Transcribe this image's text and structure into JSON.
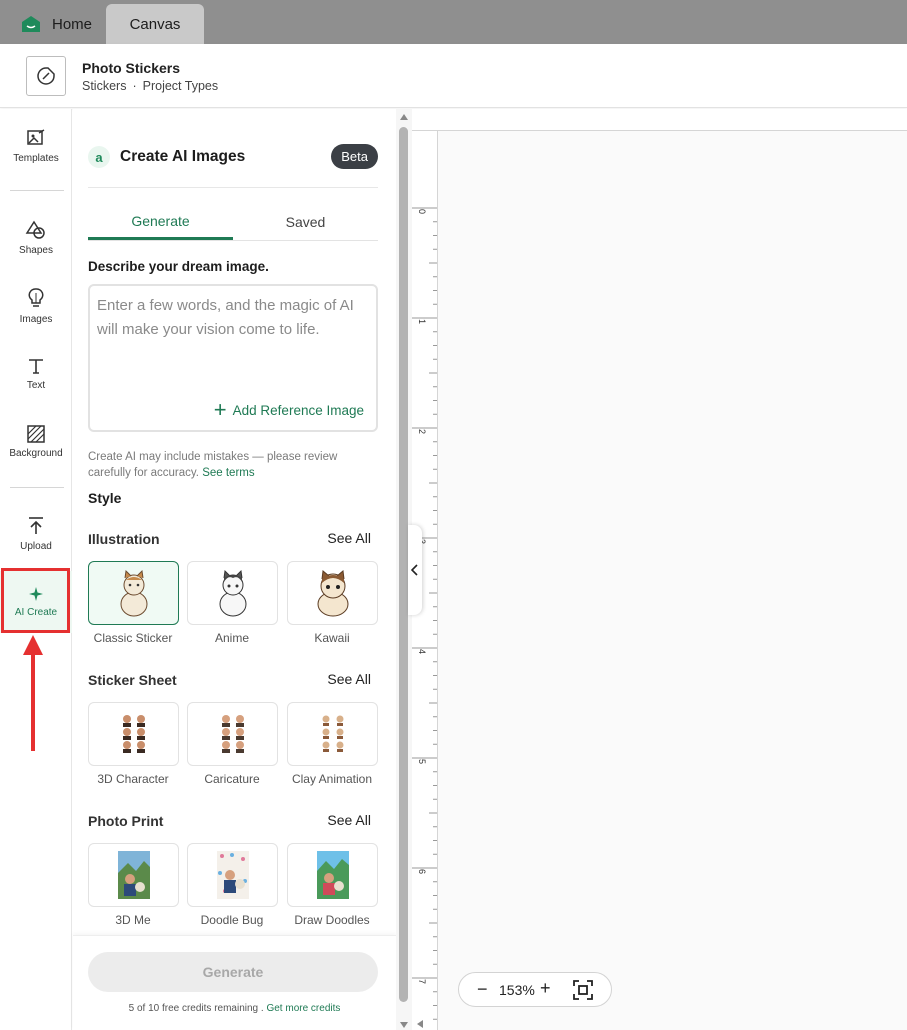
{
  "tabs": {
    "home": "Home",
    "canvas": "Canvas"
  },
  "project": {
    "title": "Photo Stickers",
    "crumb1": "Stickers",
    "sep": "·",
    "crumb2": "Project Types"
  },
  "rail": {
    "templates": "Templates",
    "shapes": "Shapes",
    "images": "Images",
    "text": "Text",
    "background": "Background",
    "upload": "Upload",
    "ai_create": "AI Create"
  },
  "panel": {
    "logo": "a",
    "title": "Create AI Images",
    "badge": "Beta",
    "tab_generate": "Generate",
    "tab_saved": "Saved",
    "describe_label": "Describe your dream image.",
    "prompt_placeholder": "Enter a few words, and the magic of AI will make your vision come to life.",
    "add_reference": "Add Reference Image",
    "disclaimer": "Create AI may include mistakes — please review carefully for accuracy.",
    "see_terms": "See terms",
    "style_label": "Style",
    "see_all": "See All",
    "sections": [
      {
        "title": "Illustration",
        "items": [
          "Classic Sticker",
          "Anime",
          "Kawaii"
        ]
      },
      {
        "title": "Sticker Sheet",
        "items": [
          "3D Character",
          "Caricature",
          "Clay Animation"
        ]
      },
      {
        "title": "Photo Print",
        "items": [
          "3D Me",
          "Doodle Bug",
          "Draw Doodles"
        ]
      }
    ],
    "generate_button": "Generate",
    "credits_text": "5 of 10 free credits remaining .",
    "get_more": "Get more credits"
  },
  "canvas": {
    "ruler_ticks": [
      "0",
      "1",
      "2",
      "3",
      "4",
      "5",
      "6",
      "7"
    ],
    "zoom_level": "153%",
    "zoom_minus": "−",
    "zoom_plus": "+"
  },
  "colors": {
    "accent": "#1f7a54",
    "highlight": "#e53030",
    "beta_bg": "#3b3f45"
  }
}
